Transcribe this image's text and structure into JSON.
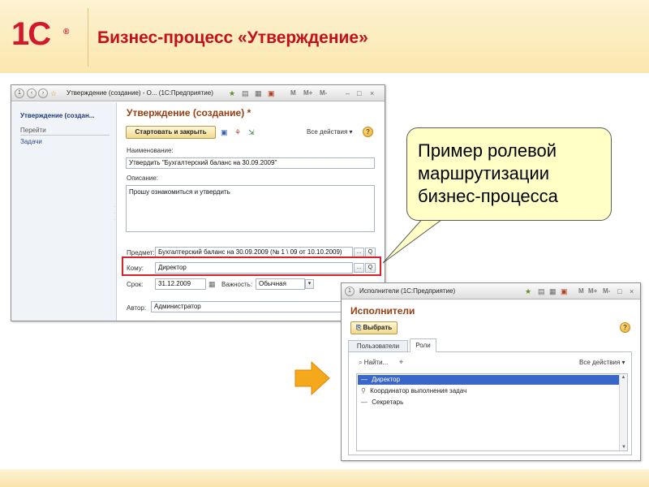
{
  "header": {
    "logo": "1С",
    "logo_mark": "®",
    "title": "Бизнес-процесс «Утверждение»"
  },
  "callout": {
    "lines": [
      "Пример ролевой",
      "маршрутизации",
      "бизнес-процесса"
    ]
  },
  "main_window": {
    "title": "Утверждение (создание) - О...  (1С:Предприятие)",
    "title_buttons": [
      "M",
      "M+",
      "M-"
    ],
    "sidebar_title": "Утверждение (создан...",
    "sidebar_section": "Перейти",
    "sidebar_items": [
      "Задачи"
    ],
    "form_title": "Утверждение (создание) *",
    "start_button": "Стартовать и закрыть",
    "all_actions": "Все действия",
    "help": "?",
    "name_label": "Наименование:",
    "name_value": "Утвердить \"Бухгалтерский баланс на 30.09.2009\"",
    "desc_label": "Описание:",
    "desc_value": "Прошу ознакомиться и утвердить",
    "subject_label": "Предмет:",
    "subject_value": "Бухгалтерский баланс на 30.09.2009 (№ 1 \\ 09 от 10.10.2009)",
    "to_label": "Кому:",
    "to_value": "Директор",
    "due_label": "Срок:",
    "due_value": "31.12.2009",
    "importance_label": "Важность:",
    "importance_value": "Обычная",
    "author_label": "Автор:",
    "author_value": "Администратор",
    "ellipsis": "...",
    "search_glyph": "Q"
  },
  "exec_window": {
    "title": "Исполнители  (1С:Предприятие)",
    "title_buttons": [
      "M",
      "M+",
      "M-"
    ],
    "heading": "Исполнители",
    "select_button": "Выбрать",
    "help": "?",
    "tabs": [
      "Пользователи",
      "Роли"
    ],
    "find": "Найти...",
    "all_actions": "Все действия",
    "roles": [
      "Директор",
      "Координатор выполнения задач",
      "Секретарь"
    ],
    "selected_index": 0
  },
  "colors": {
    "title_red": "#c4101c",
    "highlight_red": "#d4232c",
    "callout_fill": "#ffffc6",
    "arrow_orange": "#f6a81c",
    "selection_blue": "#3a66c9"
  }
}
